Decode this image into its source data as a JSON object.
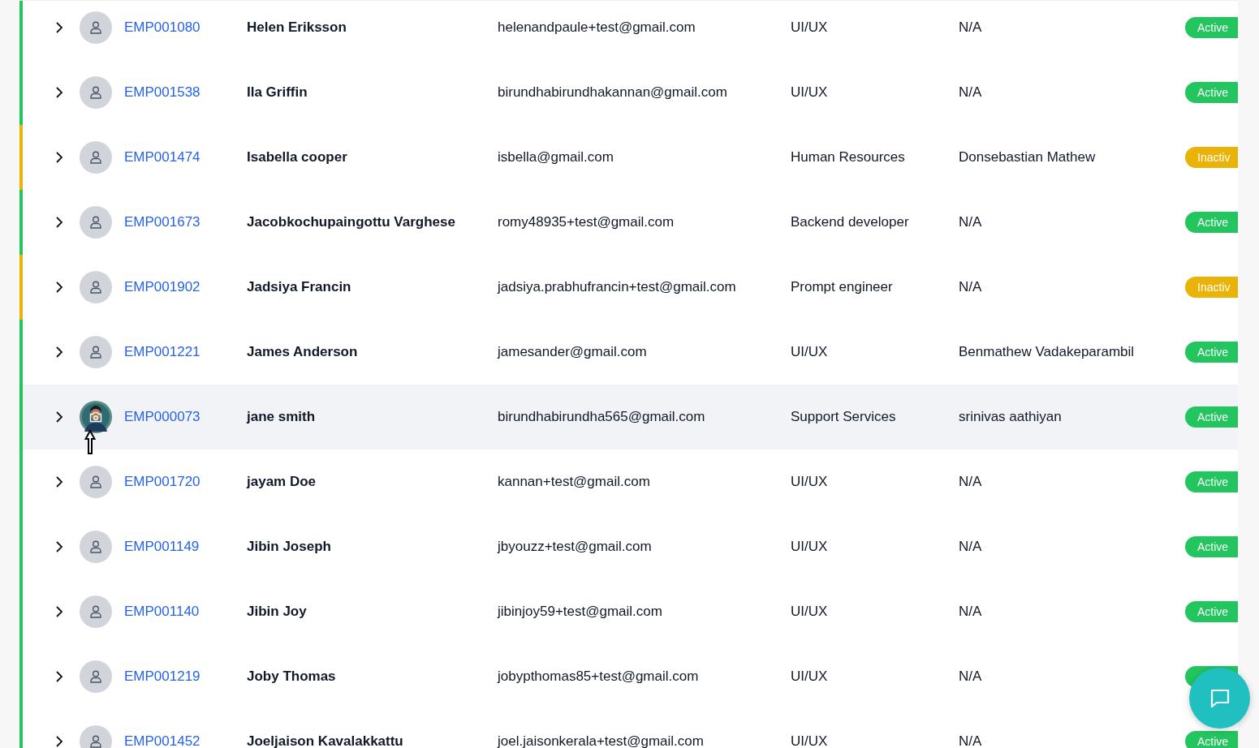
{
  "rows": [
    {
      "id": "EMP001080",
      "name": "Helen Eriksson",
      "email": "helenandpaule+test@gmail.com",
      "department": "UI/UX",
      "manager": "N/A",
      "status": {
        "label": "Active",
        "kind": "active"
      },
      "avatar": {
        "kind": "placeholder"
      },
      "selected": false
    },
    {
      "id": "EMP001538",
      "name": "Ila Griffin",
      "email": "birundhabirundhakannan@gmail.com",
      "department": "UI/UX",
      "manager": "N/A",
      "status": {
        "label": "Active",
        "kind": "active"
      },
      "avatar": {
        "kind": "placeholder"
      },
      "selected": false
    },
    {
      "id": "EMP001474",
      "name": "Isabella cooper",
      "email": "isbella@gmail.com",
      "department": "Human Resources",
      "manager": "Donsebastian Mathew",
      "status": {
        "label": "Inactiv",
        "kind": "inactive"
      },
      "avatar": {
        "kind": "placeholder"
      },
      "selected": false
    },
    {
      "id": "EMP001673",
      "name": "Jacobkochupaingottu Varghese",
      "email": "romy48935+test@gmail.com",
      "department": "Backend developer",
      "manager": "N/A",
      "status": {
        "label": "Active",
        "kind": "active"
      },
      "avatar": {
        "kind": "placeholder"
      },
      "selected": false
    },
    {
      "id": "EMP001902",
      "name": "Jadsiya Francin",
      "email": "jadsiya.prabhufrancin+test@gmail.com",
      "department": "Prompt engineer",
      "manager": "N/A",
      "status": {
        "label": "Inactiv",
        "kind": "inactive"
      },
      "avatar": {
        "kind": "placeholder"
      },
      "selected": false
    },
    {
      "id": "EMP001221",
      "name": "James Anderson",
      "email": "jamesander@gmail.com",
      "department": "UI/UX",
      "manager": "Benmathew Vadakeparambil",
      "status": {
        "label": "Active",
        "kind": "active"
      },
      "avatar": {
        "kind": "placeholder"
      },
      "selected": false
    },
    {
      "id": "EMP000073",
      "name": "jane smith",
      "email": "birundhabirundha565@gmail.com",
      "department": "Support Services",
      "manager": "srinivas aathiyan",
      "status": {
        "label": "Active",
        "kind": "active"
      },
      "selected": true
    },
    {
      "id": "EMP001720",
      "name": "jayam Doe",
      "email": "kannan+test@gmail.com",
      "department": "UI/UX",
      "manager": "N/A",
      "status": {
        "label": "Active",
        "kind": "active"
      },
      "avatar": {
        "kind": "placeholder"
      },
      "selected": false
    },
    {
      "id": "EMP001149",
      "name": "Jibin Joseph",
      "email": "jbyouzz+test@gmail.com",
      "department": "UI/UX",
      "manager": "N/A",
      "status": {
        "label": "Active",
        "kind": "active"
      },
      "avatar": {
        "kind": "placeholder"
      },
      "selected": false
    },
    {
      "id": "EMP001140",
      "name": "Jibin Joy",
      "email": "jibinjoy59+test@gmail.com",
      "department": "UI/UX",
      "manager": "N/A",
      "status": {
        "label": "Active",
        "kind": "active"
      },
      "avatar": {
        "kind": "placeholder"
      },
      "selected": false
    },
    {
      "id": "EMP001219",
      "name": "Joby Thomas",
      "email": "jobypthomas85+test@gmail.com",
      "department": "UI/UX",
      "manager": "N/A",
      "status": {
        "kind": "active"
      },
      "avatar": {
        "kind": "placeholder"
      },
      "selected": false
    },
    {
      "id": "EMP001452",
      "name": "Joeljaison Kavalakkattu",
      "email": "joel.jaisonkerala+test@gmail.com",
      "department": "UI/UX",
      "manager": "N/A",
      "status": {
        "label": "Active",
        "kind": "active"
      },
      "avatar": {
        "kind": "placeholder"
      },
      "selected": false
    }
  ]
}
